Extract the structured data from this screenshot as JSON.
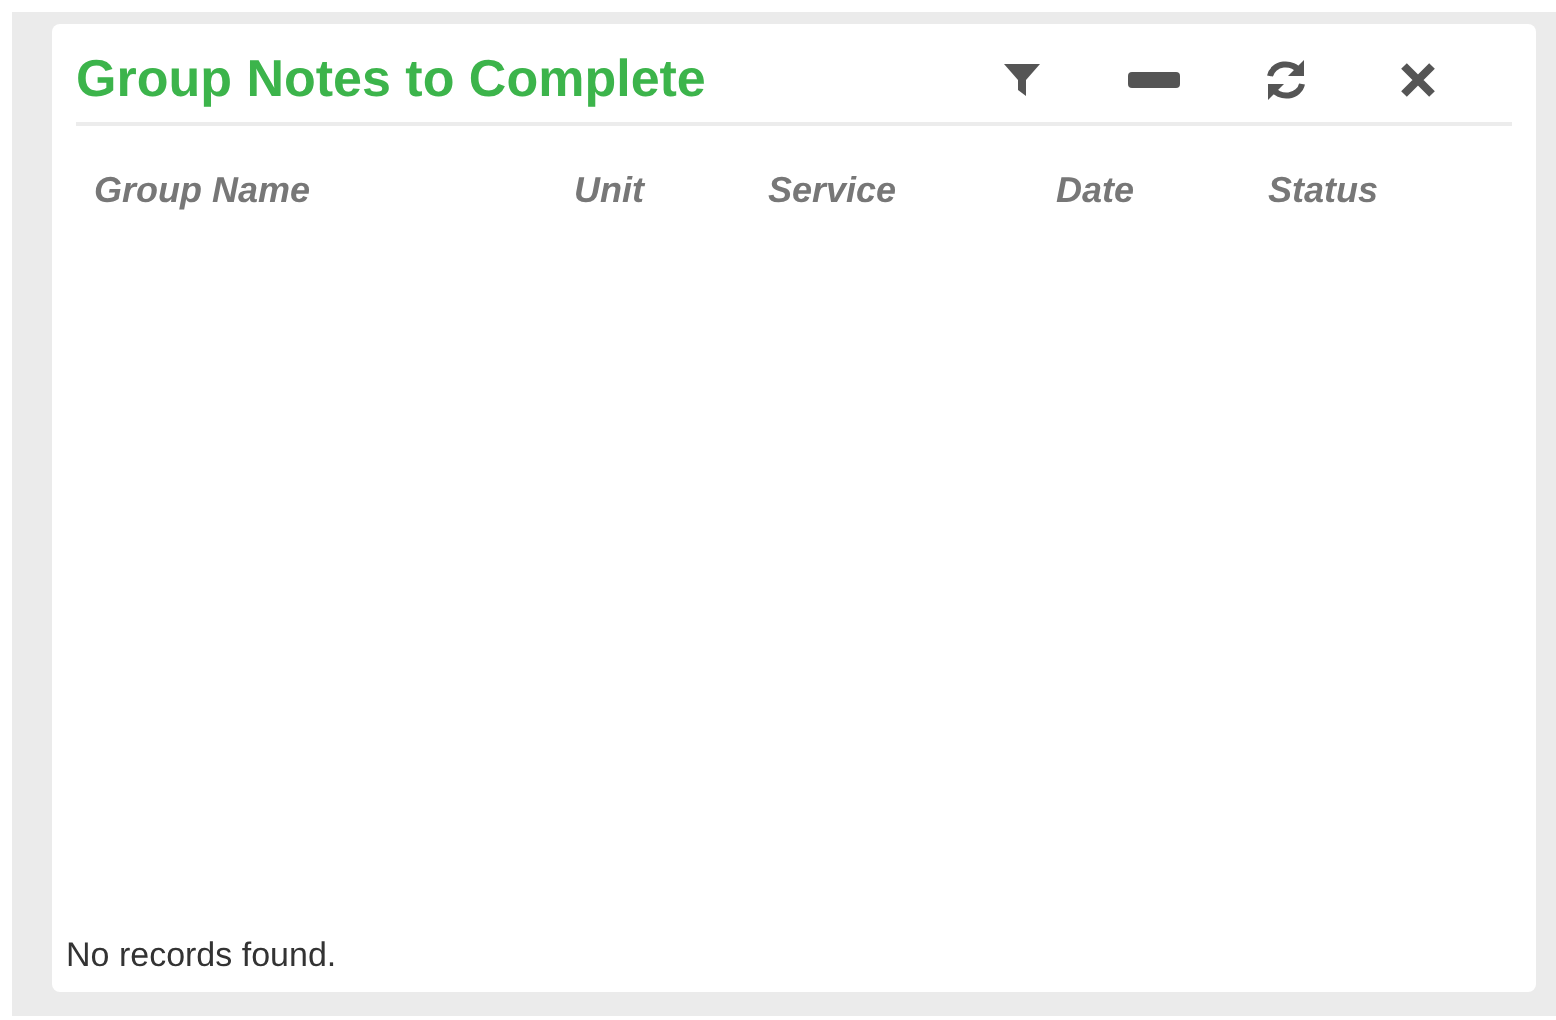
{
  "panel": {
    "title": "Group Notes to Complete",
    "tools": [
      {
        "kind": "filter"
      },
      {
        "kind": "minimize"
      },
      {
        "kind": "refresh"
      },
      {
        "kind": "close"
      }
    ],
    "columns": [
      "Group Name",
      "Unit",
      "Service",
      "Date",
      "Status"
    ],
    "empty_message": "No records found."
  }
}
